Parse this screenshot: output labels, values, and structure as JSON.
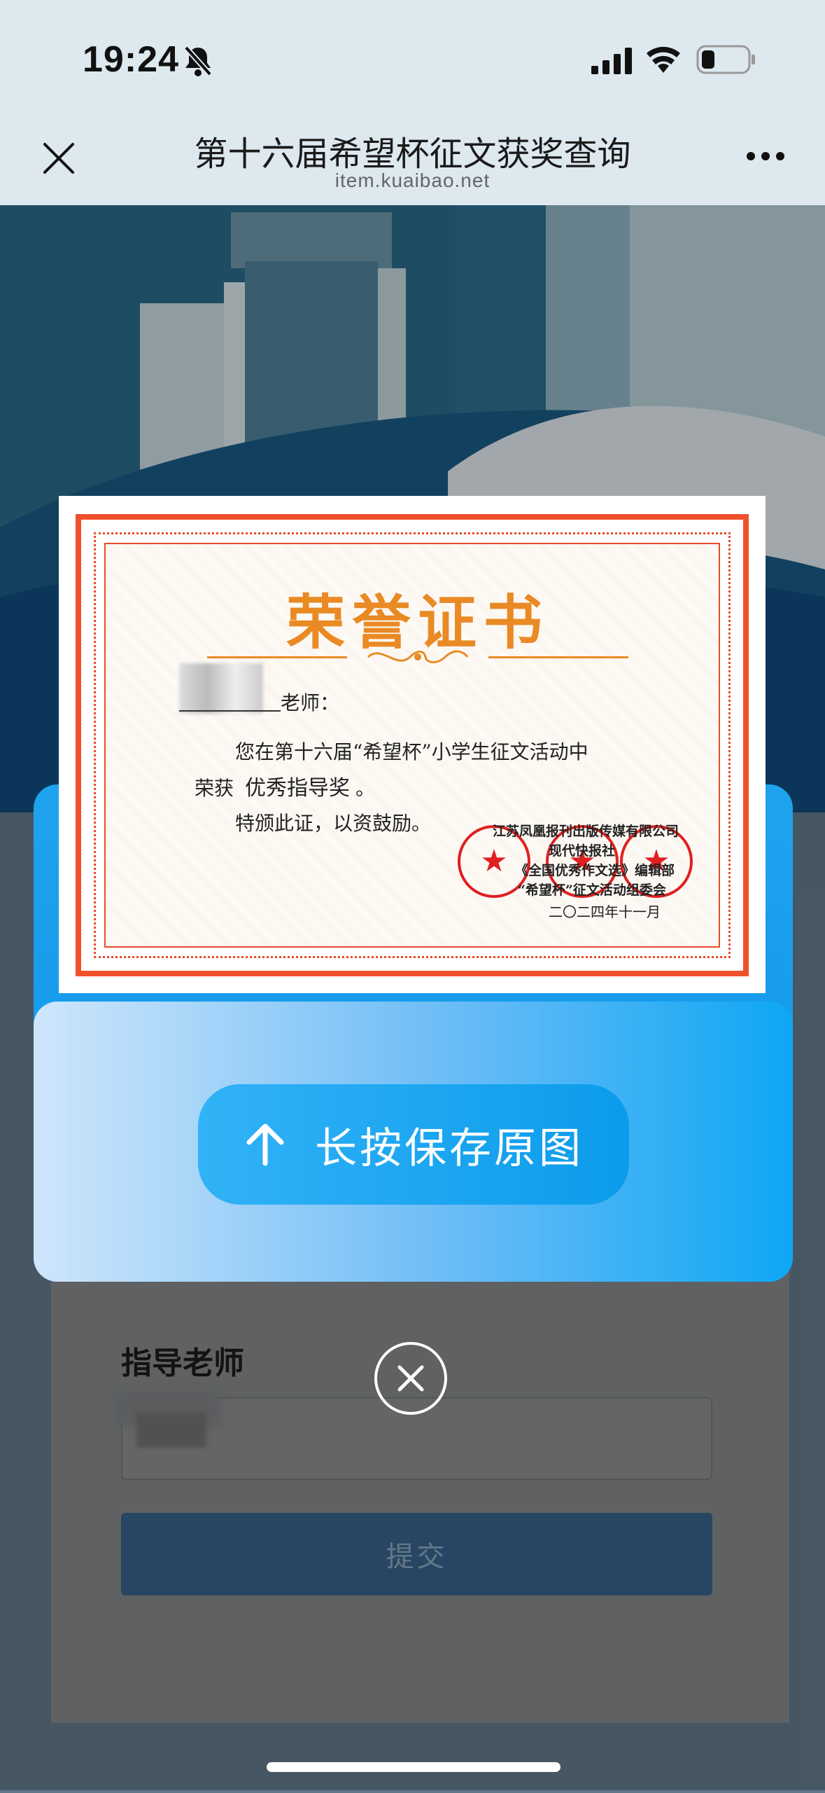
{
  "status_bar": {
    "time": "19:24"
  },
  "nav": {
    "title": "第十六届希望杯征文获奖查询",
    "url": "item.kuaibao.net"
  },
  "certificate": {
    "title": "荣誉证书",
    "salutation": "老师：",
    "line1": "您在第十六届“希望杯”小学生征文活动中",
    "award_prefix": "荣获",
    "award": "优秀指导奖",
    "award_suffix": "。",
    "closing": "特颁此证，以资鼓励。",
    "issuer_lines": [
      "江苏凤凰报刊出版传媒有限公司",
      "现代快报社",
      "《全国优秀作文选》编辑部",
      "“希望杯”征文活动组委会"
    ],
    "date": "二〇二四年十一月"
  },
  "save_button": {
    "label": "长按保存原图"
  },
  "form": {
    "teacher_label": "指导老师",
    "submit_label": "提交"
  },
  "colors": {
    "accent_blue": "#0c9ceb",
    "cert_red": "#f0512b",
    "cert_gold": "#e98a24"
  }
}
